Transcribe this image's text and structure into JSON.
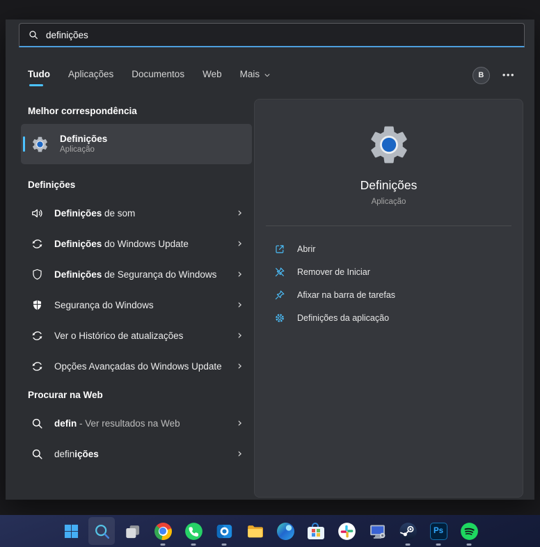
{
  "accent_color": "#4cc2ff",
  "search": {
    "value": "definições",
    "icon": "search-icon"
  },
  "header": {
    "tabs": [
      {
        "label": "Tudo",
        "active": true
      },
      {
        "label": "Aplicações",
        "active": false
      },
      {
        "label": "Documentos",
        "active": false
      },
      {
        "label": "Web",
        "active": false
      },
      {
        "label": "Mais",
        "active": false,
        "dropdown": true
      }
    ],
    "avatar": "B",
    "more_glyph": "•••"
  },
  "left": {
    "chevron_glyph": "›",
    "best_match": {
      "header": "Melhor correspondência",
      "item": {
        "icon": "settings",
        "title": "Definições",
        "subtitle": "Aplicação"
      }
    },
    "sections": [
      {
        "header": "Definições",
        "items": [
          {
            "icon": "speaker",
            "segments": [
              {
                "t": "Definições",
                "b": true
              },
              {
                "t": " de som"
              }
            ]
          },
          {
            "icon": "sync",
            "segments": [
              {
                "t": "Definições",
                "b": true
              },
              {
                "t": " do Windows Update"
              }
            ]
          },
          {
            "icon": "shield-outline",
            "segments": [
              {
                "t": "Definições",
                "b": true
              },
              {
                "t": " de Segurança do Windows"
              }
            ]
          },
          {
            "icon": "defender",
            "segments": [
              {
                "t": "Segurança do Windows"
              }
            ]
          },
          {
            "icon": "sync",
            "segments": [
              {
                "t": "Ver o Histórico de atualizações"
              }
            ]
          },
          {
            "icon": "sync",
            "segments": [
              {
                "t": "Opções Avançadas do Windows Update"
              }
            ]
          }
        ]
      },
      {
        "header": "Procurar na Web",
        "items": [
          {
            "icon": "search",
            "segments": [
              {
                "t": "defin",
                "b": true
              },
              {
                "t": " - Ver resultados na Web",
                "dim": true
              }
            ]
          },
          {
            "icon": "search",
            "segments": [
              {
                "t": "defin"
              },
              {
                "t": "ições",
                "b": true
              }
            ]
          }
        ]
      }
    ]
  },
  "preview": {
    "icon": "settings",
    "title": "Definições",
    "subtitle": "Aplicação",
    "actions": [
      {
        "icon": "open",
        "label": "Abrir"
      },
      {
        "icon": "unpin",
        "label": "Remover de Iniciar"
      },
      {
        "icon": "pin",
        "label": "Afixar na barra de tarefas"
      },
      {
        "icon": "gear",
        "label": "Definições da aplicação"
      }
    ]
  },
  "taskbar": {
    "items": [
      {
        "name": "start",
        "icon": "windows",
        "active": false,
        "running": false
      },
      {
        "name": "search",
        "icon": "search-tb",
        "active": true,
        "running": false
      },
      {
        "name": "task-view",
        "icon": "taskview",
        "active": false,
        "running": false
      },
      {
        "name": "chrome",
        "icon": "chrome",
        "active": false,
        "running": true
      },
      {
        "name": "whatsapp",
        "icon": "whatsapp",
        "active": false,
        "running": true
      },
      {
        "name": "outlook",
        "icon": "outlook",
        "active": false,
        "running": true
      },
      {
        "name": "file-explorer",
        "icon": "explorer",
        "active": false,
        "running": false
      },
      {
        "name": "edge",
        "icon": "edge",
        "active": false,
        "running": false
      },
      {
        "name": "microsoft-store",
        "icon": "store",
        "active": false,
        "running": false
      },
      {
        "name": "slack",
        "icon": "slack",
        "active": false,
        "running": false
      },
      {
        "name": "this-pc",
        "icon": "pc",
        "active": false,
        "running": false
      },
      {
        "name": "steam",
        "icon": "steam",
        "active": false,
        "running": true
      },
      {
        "name": "photoshop",
        "icon": "photoshop",
        "active": false,
        "running": true,
        "label": "Ps"
      },
      {
        "name": "spotify",
        "icon": "spotify",
        "active": false,
        "running": true
      }
    ]
  }
}
